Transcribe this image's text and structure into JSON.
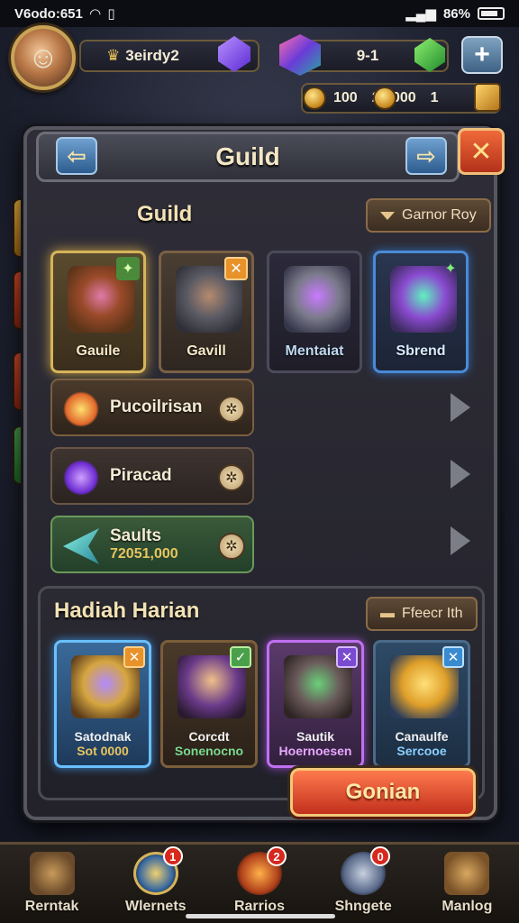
{
  "status_bar": {
    "time": "V6odo:651",
    "battery": "86%"
  },
  "hud": {
    "player_name": "3eirdy2",
    "stage": "9-1",
    "currency_a": "100",
    "currency_b": "20.000",
    "currency_b_suffix": "1",
    "plus_label": "+"
  },
  "panel": {
    "title": "Guild",
    "close_label": "✕"
  },
  "guild_section": {
    "title": "Guild",
    "sort_label": "Garnor Roy",
    "cards": [
      {
        "label": "Gauile",
        "badge": "✦"
      },
      {
        "label": "Gavill",
        "badge": "✕"
      },
      {
        "label": "Mentaiat",
        "badge": ""
      },
      {
        "label": "Sbrend",
        "badge": "✦"
      }
    ],
    "rows": [
      {
        "label": "Pucoilrisan",
        "sub": ""
      },
      {
        "label": "Piracad",
        "sub": ""
      },
      {
        "label": "Saults",
        "sub": "72051,000"
      }
    ]
  },
  "rewards_section": {
    "title": "Hadiah Harian",
    "filter_label": "Ffeecr Ith",
    "cards": [
      {
        "name": "Satodnak",
        "value": "Sot 0000",
        "badge": "✕"
      },
      {
        "name": "Corcdt",
        "value": "Sonenocno",
        "badge": "✓"
      },
      {
        "name": "Sautik",
        "value": "Hoernoesen",
        "badge": "✕"
      },
      {
        "name": "Canaulfe",
        "value": "Sercooe",
        "badge": "✕"
      }
    ],
    "claim_label": "Gonian"
  },
  "bottom_nav": [
    {
      "label": "Rerntak",
      "badge": ""
    },
    {
      "label": "Wlernets",
      "badge": "1"
    },
    {
      "label": "Rarrios",
      "badge": "2"
    },
    {
      "label": "Shngete",
      "badge": "0"
    },
    {
      "label": "Manlog",
      "badge": ""
    }
  ],
  "colors": {
    "accent_gold": "#e7c55f",
    "claim_red": "#c2301c",
    "nav_blue": "#2d5c8e"
  }
}
